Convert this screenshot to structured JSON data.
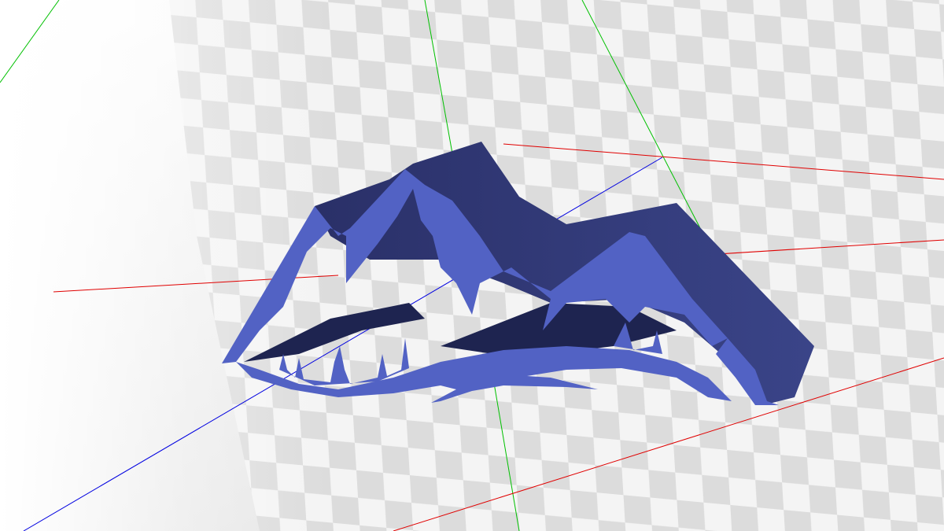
{
  "viewport": {
    "background_top": "#ffffff",
    "background_bottom": "#d9d9d9",
    "checker_light": "#f4f4f4",
    "checker_dark": "#dcdcdc"
  },
  "axes": {
    "x_color": "#e00000",
    "y_color": "#00c000",
    "z_color": "#0000e0"
  },
  "model": {
    "face_color": "#5262c4",
    "shade_color": "#2e3672",
    "deep_shade_color": "#1e2450"
  }
}
